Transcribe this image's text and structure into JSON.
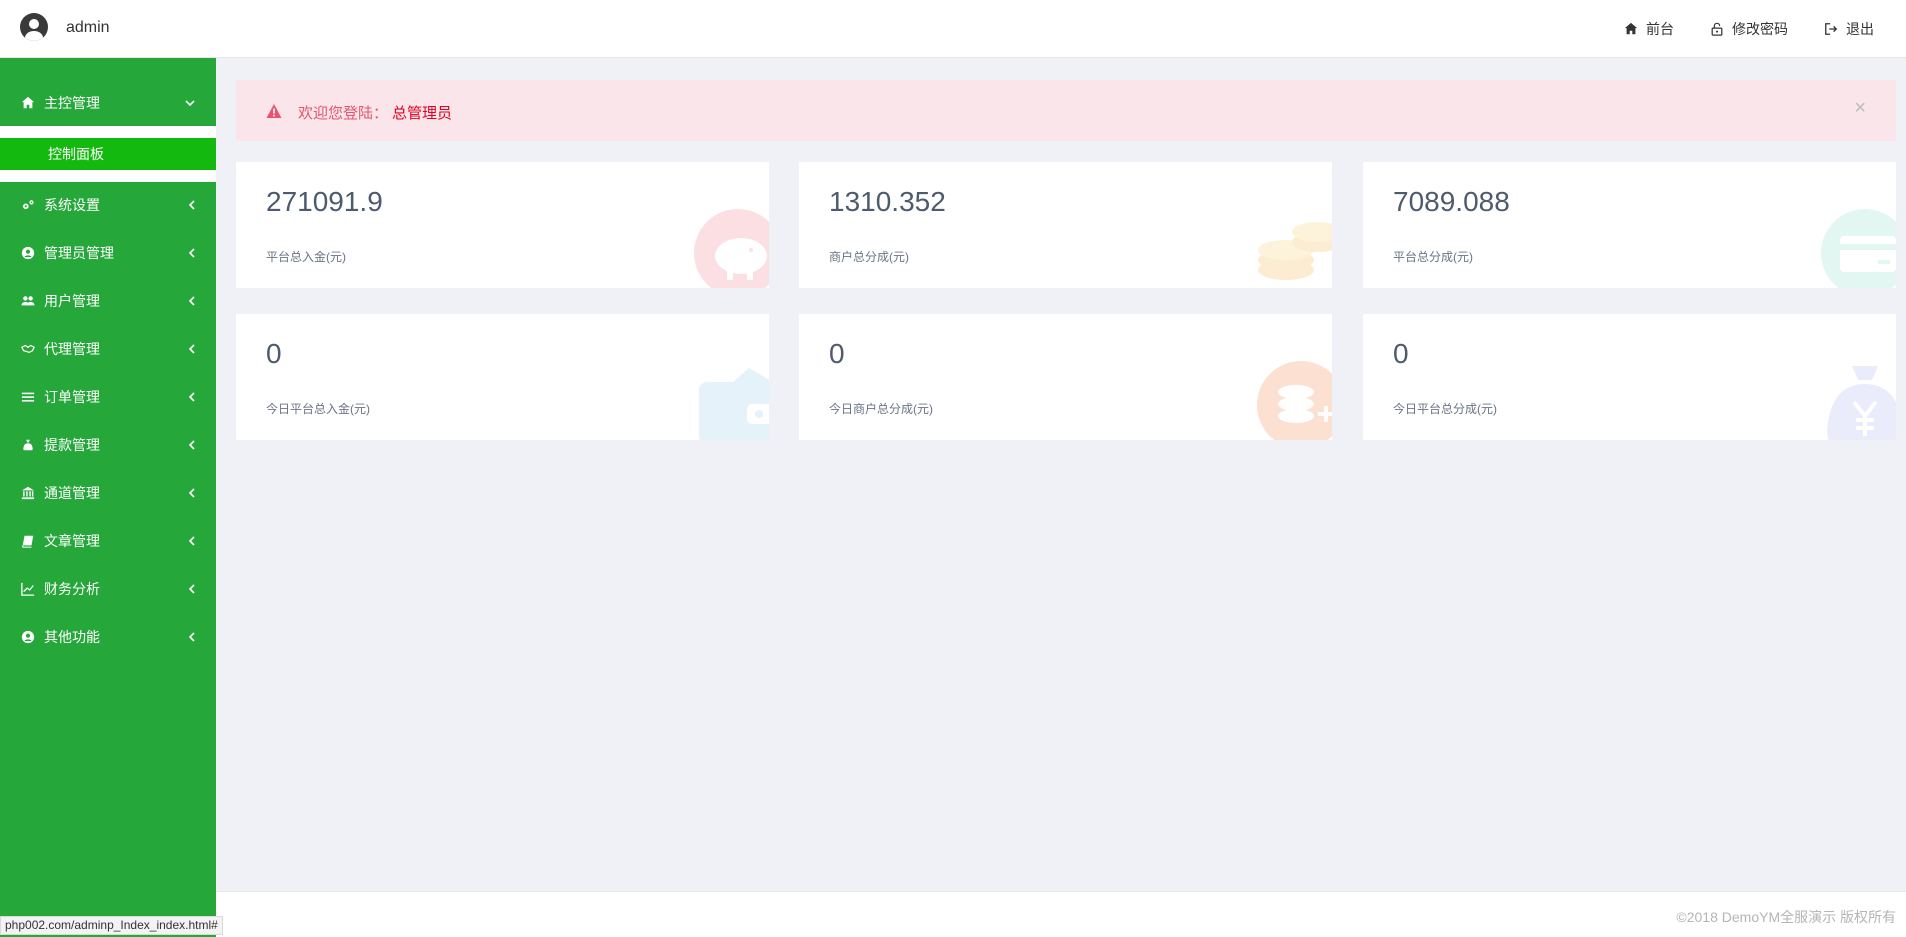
{
  "header": {
    "username": "admin",
    "nav": [
      {
        "label": "前台",
        "icon": "home-icon"
      },
      {
        "label": "修改密码",
        "icon": "unlock-icon"
      },
      {
        "label": "退出",
        "icon": "sign-out-icon"
      }
    ]
  },
  "sidebar": {
    "items": [
      {
        "label": "主控管理",
        "icon": "home-icon",
        "expanded": true
      },
      {
        "label": "系统设置",
        "icon": "gears-icon"
      },
      {
        "label": "管理员管理",
        "icon": "user-circle-icon"
      },
      {
        "label": "用户管理",
        "icon": "users-icon"
      },
      {
        "label": "代理管理",
        "icon": "handshake-icon"
      },
      {
        "label": "订单管理",
        "icon": "list-icon"
      },
      {
        "label": "提款管理",
        "icon": "money-bag-icon"
      },
      {
        "label": "通道管理",
        "icon": "bank-icon"
      },
      {
        "label": "文章管理",
        "icon": "book-icon"
      },
      {
        "label": "财务分析",
        "icon": "line-chart-icon"
      },
      {
        "label": "其他功能",
        "icon": "user-circle-icon"
      }
    ],
    "sub_active": "控制面板"
  },
  "alert": {
    "prefix": "欢迎您登陆：",
    "role": "总管理员",
    "close": "×"
  },
  "stats": [
    {
      "value": "271091.9",
      "label": "平台总入金(元)",
      "icon": "piggy-bank-icon",
      "color": "#e5001e"
    },
    {
      "value": "1310.352",
      "label": "商户总分成(元)",
      "icon": "coins-icon",
      "color": "#f5a623"
    },
    {
      "value": "7089.088",
      "label": "平台总分成(元)",
      "icon": "credit-card-icon",
      "color": "#1abc9c"
    },
    {
      "value": "0",
      "label": "今日平台总入金(元)",
      "icon": "wallet-icon",
      "color": "#3498db"
    },
    {
      "value": "0",
      "label": "今日商户总分成(元)",
      "icon": "coin-add-icon",
      "color": "#f26b1d"
    },
    {
      "value": "0",
      "label": "今日平台总分成(元)",
      "icon": "yuan-bag-icon",
      "color": "#5b6ee1"
    }
  ],
  "footer": {
    "copyright": "©2018 DemoYM全服演示 版权所有"
  },
  "status_bar": {
    "url": "php002.com/adminp_Index_index.html#"
  }
}
